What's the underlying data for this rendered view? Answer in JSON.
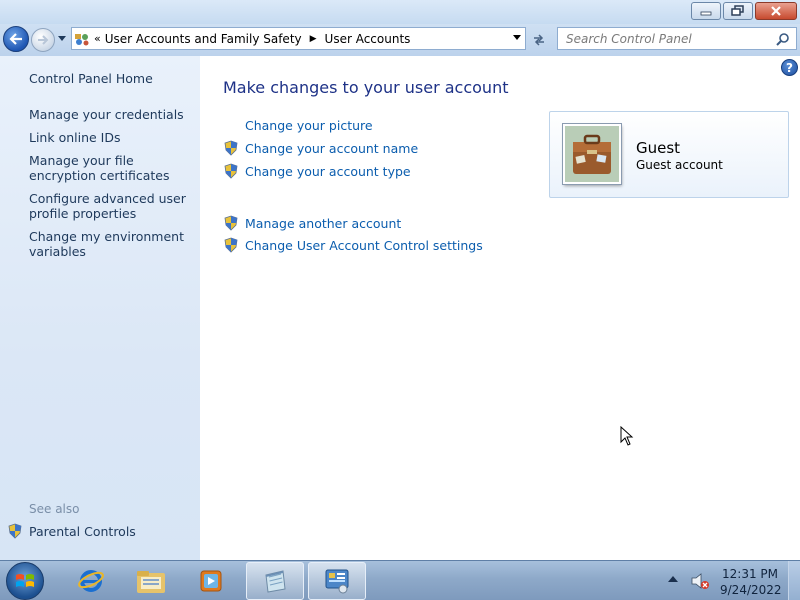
{
  "window": {
    "minimize_label": "minimize",
    "restore_label": "restore",
    "close_label": "close"
  },
  "address": {
    "overflow": "«",
    "crumbs": [
      "User Accounts and Family Safety",
      "User Accounts"
    ]
  },
  "search": {
    "placeholder": "Search Control Panel"
  },
  "sidebar": {
    "home": "Control Panel Home",
    "links": [
      "Manage your credentials",
      "Link online IDs",
      "Manage your file encryption certificates",
      "Configure advanced user profile properties",
      "Change my environment variables"
    ],
    "see_also": "See also",
    "parental": "Parental Controls"
  },
  "main": {
    "title": "Make changes to your user account",
    "tasks": [
      {
        "label": "Change your picture",
        "shield": false
      },
      {
        "label": "Change your account name",
        "shield": true
      },
      {
        "label": "Change your account type",
        "shield": true
      },
      {
        "label": "Manage another account",
        "shield": true
      },
      {
        "label": "Change User Account Control settings",
        "shield": true
      }
    ],
    "account": {
      "name": "Guest",
      "type": "Guest account"
    },
    "help": "?"
  },
  "taskbar": {
    "apps": [
      "internet-explorer-icon",
      "windows-explorer-icon",
      "media-player-icon",
      "notepad-icon",
      "control-panel-icon"
    ],
    "active_app": "control-panel-icon",
    "time": "12:31 PM",
    "date": "9/24/2022"
  },
  "colors": {
    "link": "#0b5dae",
    "title": "#1e3287",
    "sidebar_bg": "#dbe7f6",
    "taskbar": "#8ea9c9"
  }
}
